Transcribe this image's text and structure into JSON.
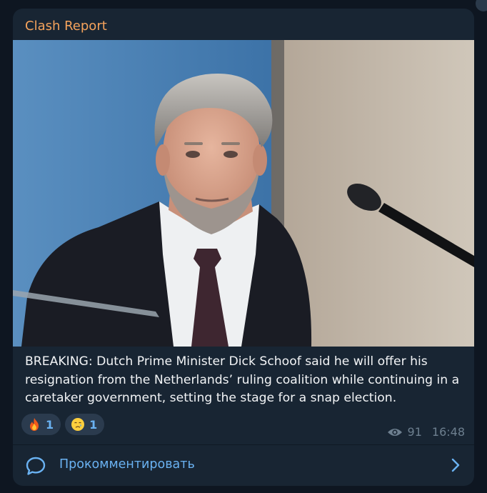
{
  "post": {
    "channel_name": "Clash Report",
    "image_alt": "Dutch Prime Minister Dick Schoof at a podium microphone",
    "text": "BREAKING: Dutch Prime Minister Dick Schoof said he will offer his resignation from the Netherlands’ ruling coalition while continuing in a caretaker government, setting the stage for a snap election.",
    "reactions": [
      {
        "emoji": "fire-emoji",
        "count": "1"
      },
      {
        "emoji": "crying-face-emoji",
        "count": "1"
      }
    ],
    "views": "91",
    "time": "16:48"
  },
  "comments": {
    "label": "Прокомментировать"
  },
  "colors": {
    "background": "#0e1621",
    "bubble": "#182533",
    "channel_name": "#f5a35c",
    "accent": "#6ab2f2",
    "meta": "#6d7f8f"
  }
}
